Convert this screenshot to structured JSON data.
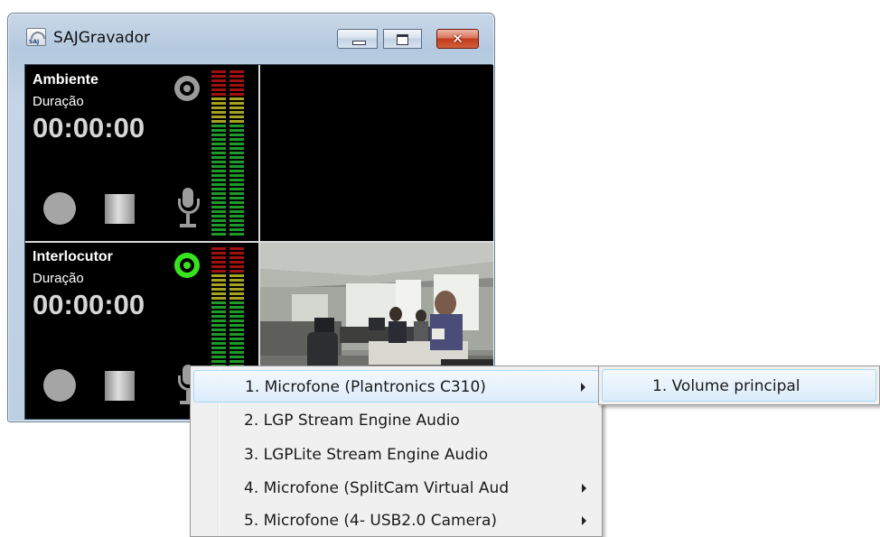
{
  "window": {
    "title": "SAJGravador",
    "icon": "saj-app-icon",
    "icon_text": "SAJ",
    "buttons": {
      "minimize": "minimize-icon",
      "maximize": "maximize-icon",
      "close": "✕"
    }
  },
  "panels": [
    {
      "name": "Ambiente",
      "duration_label": "Duração",
      "duration": "00:00:00",
      "monitor_active": false
    },
    {
      "name": "Interlocutor",
      "duration_label": "Duração",
      "duration": "00:00:00",
      "monitor_active": true
    }
  ],
  "colors": {
    "meter_red": "#a01010",
    "meter_yellow": "#a8a222",
    "meter_green": "#1f9a2a",
    "active_monitor": "#37e31d",
    "menu_highlight": "#dcecfb"
  },
  "context_menu": {
    "items": [
      {
        "label": "1. Microfone (Plantronics C310)",
        "has_submenu": true,
        "highlighted": true
      },
      {
        "label": "2. LGP Stream Engine Audio",
        "has_submenu": false
      },
      {
        "label": "3. LGPLite Stream Engine Audio",
        "has_submenu": false
      },
      {
        "label": "4. Microfone (SplitCam Virtual Aud",
        "has_submenu": true
      },
      {
        "label": "5. Microfone (4- USB2.0 Camera)",
        "has_submenu": true
      }
    ]
  },
  "submenu": {
    "items": [
      {
        "label": "1. Volume principal",
        "highlighted": true
      }
    ]
  }
}
